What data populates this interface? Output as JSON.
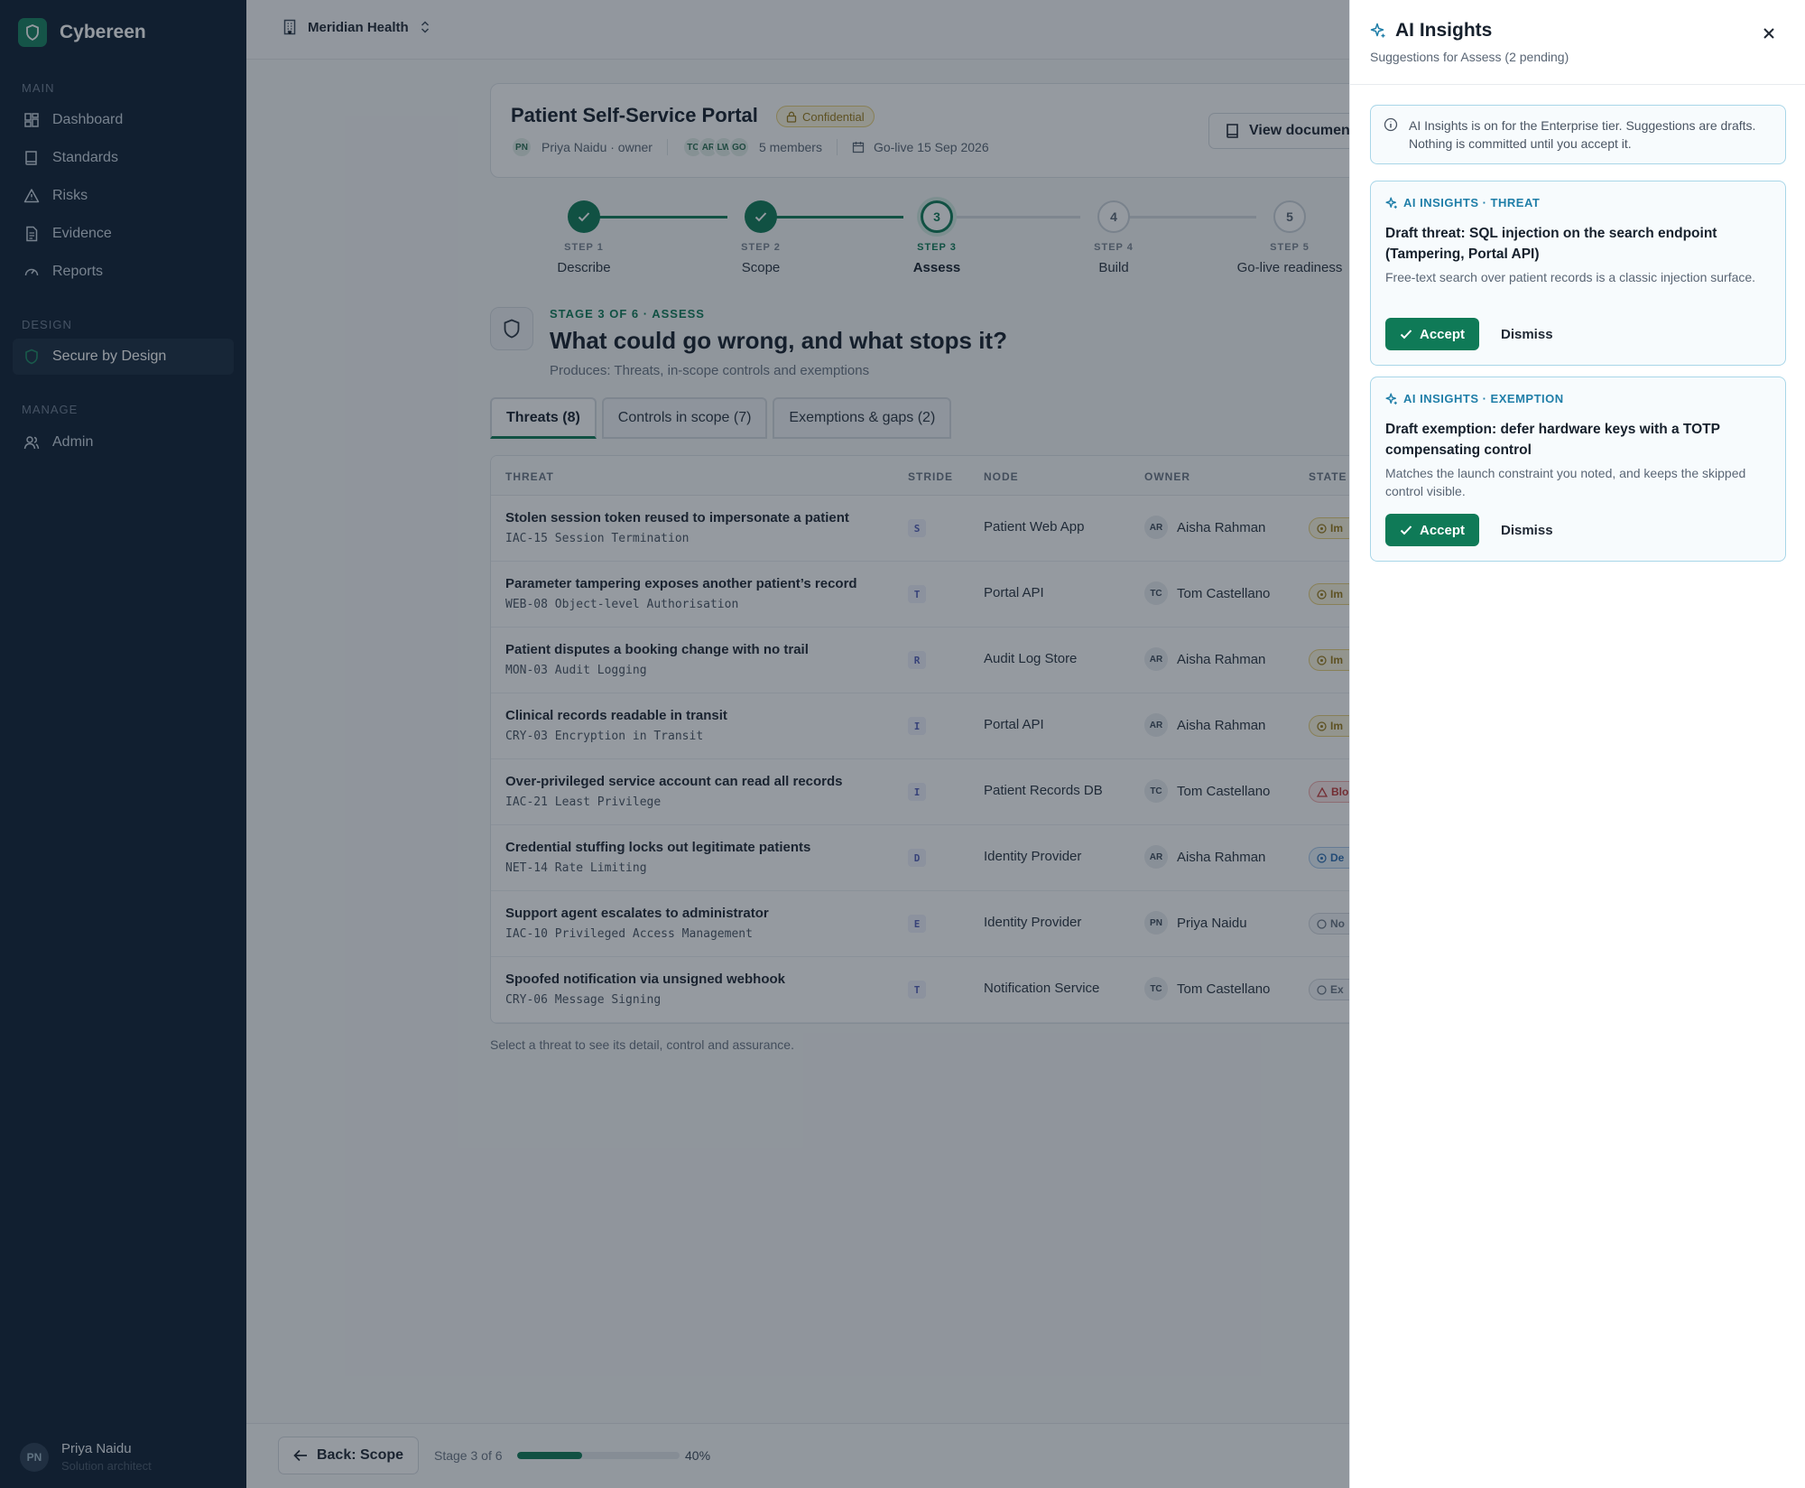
{
  "app": {
    "name": "Cybereen"
  },
  "sidebar": {
    "sections": [
      {
        "label": "MAIN",
        "items": [
          {
            "label": "Dashboard",
            "icon": "dashboard-icon"
          },
          {
            "label": "Standards",
            "icon": "book-icon"
          },
          {
            "label": "Risks",
            "icon": "warning-icon"
          },
          {
            "label": "Evidence",
            "icon": "document-icon"
          },
          {
            "label": "Reports",
            "icon": "gauge-icon"
          }
        ]
      },
      {
        "label": "DESIGN",
        "items": [
          {
            "label": "Secure by Design",
            "icon": "shield-icon",
            "active": true
          }
        ]
      },
      {
        "label": "MANAGE",
        "items": [
          {
            "label": "Admin",
            "icon": "users-icon"
          }
        ]
      }
    ],
    "user": {
      "initials": "PN",
      "name": "Priya Naidu",
      "role": "Solution architect"
    }
  },
  "topbar": {
    "org": "Meridian Health"
  },
  "project": {
    "title": "Patient Self-Service Portal",
    "classification": "Confidential",
    "owner_initials": "PN",
    "owner": "Priya Naidu · owner",
    "member_initials": [
      "TC",
      "AR",
      "LW",
      "GO"
    ],
    "members": "5 members",
    "golive": "Go-live 15 Sep 2026",
    "view_doc": "View documen"
  },
  "stepper": [
    {
      "label": "STEP 1",
      "name": "Describe",
      "status": "done",
      "num": "1"
    },
    {
      "label": "STEP 2",
      "name": "Scope",
      "status": "done",
      "num": "2"
    },
    {
      "label": "STEP 3",
      "name": "Assess",
      "status": "current",
      "num": "3"
    },
    {
      "label": "STEP 4",
      "name": "Build",
      "status": "todo",
      "num": "4"
    },
    {
      "label": "STEP 5",
      "name": "Go-live readiness",
      "status": "todo",
      "num": "5"
    }
  ],
  "stage": {
    "kicker": "STAGE 3 OF 6 · ASSESS",
    "title": "What could go wrong, and what stops it?",
    "subtitle": "Produces: Threats, in-scope controls and exemptions"
  },
  "tabs": [
    "Threats (8)",
    "Controls in scope (7)",
    "Exemptions & gaps (2)"
  ],
  "table": {
    "headers": [
      "THREAT",
      "STRIDE",
      "NODE",
      "OWNER",
      "STATE"
    ],
    "rows": [
      {
        "title": "Stolen session token reused to impersonate a patient",
        "control": "IAC-15 Session Termination",
        "stride": "S",
        "node": "Patient Web App",
        "owner_initials": "AR",
        "owner": "Aisha Rahman",
        "state": "Im",
        "state_kind": "impl"
      },
      {
        "title": "Parameter tampering exposes another patient’s record",
        "control": "WEB-08 Object-level Authorisation",
        "stride": "T",
        "node": "Portal API",
        "owner_initials": "TC",
        "owner": "Tom Castellano",
        "state": "Im",
        "state_kind": "impl"
      },
      {
        "title": "Patient disputes a booking change with no trail",
        "control": "MON-03 Audit Logging",
        "stride": "R",
        "node": "Audit Log Store",
        "owner_initials": "AR",
        "owner": "Aisha Rahman",
        "state": "Im",
        "state_kind": "impl"
      },
      {
        "title": "Clinical records readable in transit",
        "control": "CRY-03 Encryption in Transit",
        "stride": "I",
        "node": "Portal API",
        "owner_initials": "AR",
        "owner": "Aisha Rahman",
        "state": "Im",
        "state_kind": "impl"
      },
      {
        "title": "Over-privileged service account can read all records",
        "control": "IAC-21 Least Privilege",
        "stride": "I",
        "node": "Patient Records DB",
        "owner_initials": "TC",
        "owner": "Tom Castellano",
        "state": "Blo",
        "state_kind": "blk"
      },
      {
        "title": "Credential stuffing locks out legitimate patients",
        "control": "NET-14 Rate Limiting",
        "stride": "D",
        "node": "Identity Provider",
        "owner_initials": "AR",
        "owner": "Aisha Rahman",
        "state": "De",
        "state_kind": "def"
      },
      {
        "title": "Support agent escalates to administrator",
        "control": "IAC-10 Privileged Access Management",
        "stride": "E",
        "node": "Identity Provider",
        "owner_initials": "PN",
        "owner": "Priya Naidu",
        "state": "No",
        "state_kind": "no"
      },
      {
        "title": "Spoofed notification via unsigned webhook",
        "control": "CRY-06 Message Signing",
        "stride": "T",
        "node": "Notification Service",
        "owner_initials": "TC",
        "owner": "Tom Castellano",
        "state": "Ex",
        "state_kind": "no"
      }
    ],
    "hint": "Select a threat to see its detail, control and assurance."
  },
  "footer": {
    "back": "Back: Scope",
    "stage_count": "Stage 3 of 6",
    "progress": 0.4,
    "progress_label": "40%"
  },
  "drawer": {
    "title": "AI Insights",
    "subtitle": "Suggestions for Assess (2 pending)",
    "info": "AI Insights is on for the Enterprise tier. Suggestions are drafts. Nothing is committed until you accept it.",
    "suggestions": [
      {
        "kicker": "AI INSIGHTS · THREAT",
        "title": "Draft threat: SQL injection on the search endpoint (Tampering, Portal API)",
        "body": "Free-text search over patient records is a classic injection surface.",
        "accept": "Accept",
        "dismiss": "Dismiss"
      },
      {
        "kicker": "AI INSIGHTS · EXEMPTION",
        "title": "Draft exemption: defer hardware keys with a TOTP compensating control",
        "body": "Matches the launch constraint you noted, and keeps the skipped control visible.",
        "accept": "Accept",
        "dismiss": "Dismiss"
      }
    ]
  },
  "colors": {
    "brand": "#0f7a57",
    "sidebar": "#0f1f33",
    "ai_accent": "#1f7ea8"
  }
}
